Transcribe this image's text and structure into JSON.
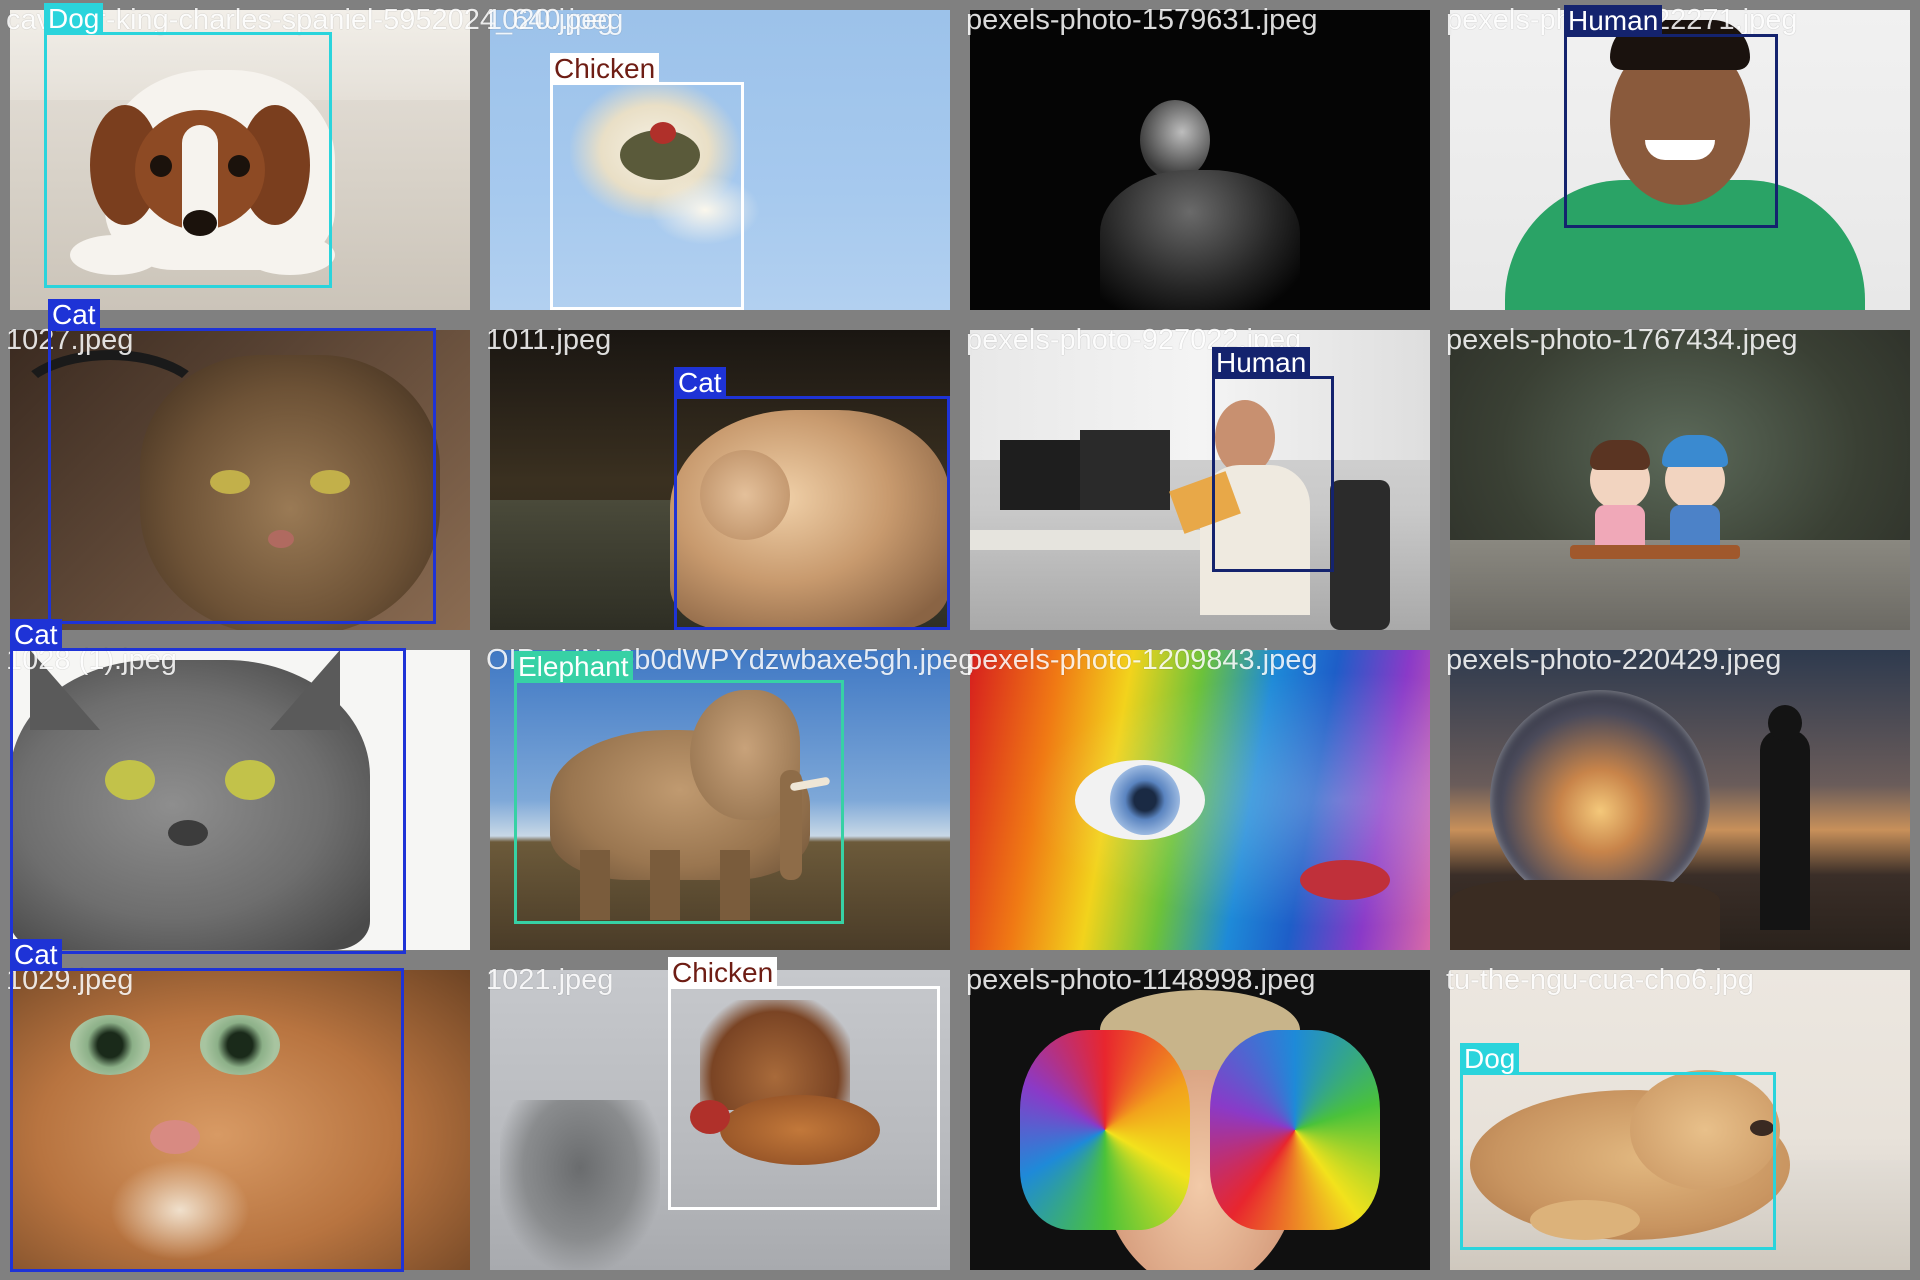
{
  "colors": {
    "frame": "#808080",
    "dog": "#2ad4dc",
    "cat": "#1e33d6",
    "human": "#14236e",
    "chicken": "#ffffff",
    "elephant": "#37d1a5"
  },
  "tiles": [
    {
      "filename": "cavalier-king-charles-spaniel-5952024_640.jpeg",
      "filename2": "1020.jpeg",
      "label": "Dog"
    },
    {
      "filename": "1020.jpeg",
      "label": "Chicken"
    },
    {
      "filename": "pexels-photo-1579631.jpeg",
      "label": ""
    },
    {
      "filename": "pexels-photo-1222271.jpeg",
      "label": "Human"
    },
    {
      "filename": "1027.jpeg",
      "label": "Cat"
    },
    {
      "filename": "1011.jpeg",
      "label": "Cat"
    },
    {
      "filename": "pexels-photo-927022.jpeg",
      "label": "Human"
    },
    {
      "filename": "pexels-photo-1767434.jpeg",
      "label": ""
    },
    {
      "filename": "1028 (1).jpeg",
      "label": "Cat"
    },
    {
      "filename": "OIP-zHNg0b0dWPYdzwbaxe5gh.jpeg",
      "label": "Elephant"
    },
    {
      "filename": "pexels-photo-1209843.jpeg",
      "label": ""
    },
    {
      "filename": "pexels-photo-220429.jpeg",
      "label": ""
    },
    {
      "filename": "1029.jpeg",
      "label": "Cat"
    },
    {
      "filename": "1021.jpeg",
      "label": "Chicken"
    },
    {
      "filename": "pexels-photo-1148998.jpeg",
      "label": ""
    },
    {
      "filename": "tu-the-ngu-cua-cho6.jpg",
      "label": "Dog"
    }
  ]
}
